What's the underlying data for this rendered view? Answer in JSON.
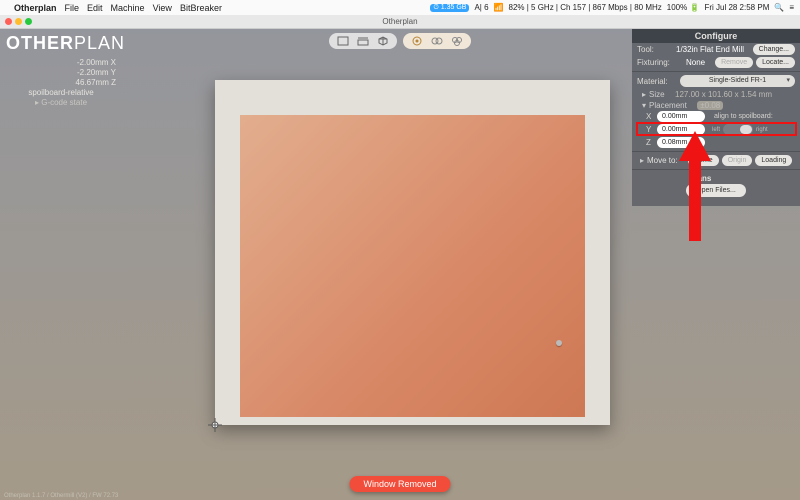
{
  "menubar": {
    "app": "Otherplan",
    "items": [
      "File",
      "Edit",
      "Machine",
      "View",
      "BitBreaker"
    ],
    "status": {
      "mem": "1.35 GB",
      "adobe": "A| 6",
      "wifi": "82% | 5 GHz | Ch 157 | 867 Mbps | 80 MHz",
      "battery": "100%",
      "datetime": "Fri Jul 28  2:58 PM"
    }
  },
  "window": {
    "title": "Otherplan"
  },
  "logo": {
    "a": "OTHER",
    "b": "PLAN"
  },
  "coords": {
    "x": "-2.00mm X",
    "y": "-2.20mm Y",
    "z": "46.67mm Z",
    "mode": "spoilboard-relative",
    "gstate": "G-code state"
  },
  "panel": {
    "title": "Configure",
    "tool": {
      "label": "Tool:",
      "value": "1/32in Flat End Mill",
      "change": "Change..."
    },
    "fixture": {
      "label": "Fixturing:",
      "value": "None",
      "remove": "Remove",
      "locate": "Locate..."
    },
    "material": {
      "label": "Material:",
      "value": "Single-Sided FR-1"
    },
    "size": {
      "label": "Size",
      "value": "127.00 x 101.60 x 1.54 mm"
    },
    "placement": {
      "label": "Placement",
      "delta": "±0.08",
      "x": "0.00mm",
      "y": "0.00mm",
      "z": "0.08mm",
      "align": "align to spoilboard:",
      "toggle_left": "left",
      "toggle_right": "right"
    },
    "move": {
      "label": "Move to:",
      "home": "Home",
      "origin": "Origin",
      "loading": "Loading"
    },
    "plans": {
      "label": "Plans",
      "open": "Open Files..."
    }
  },
  "banner": "Window Removed",
  "footer": "Otherplan 1.1.7 / Othermill (V2) / FW 72.73"
}
